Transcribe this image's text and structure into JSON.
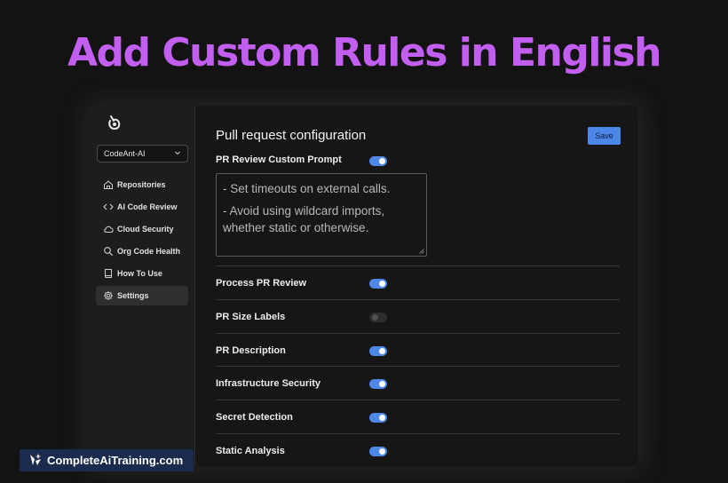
{
  "headline": "Add Custom Rules in English",
  "sidebar": {
    "org_selector": "CodeAnt-AI",
    "items": [
      {
        "label": "Repositories",
        "icon": "home-icon",
        "active": false
      },
      {
        "label": "AI Code Review",
        "icon": "code-icon",
        "active": false
      },
      {
        "label": "Cloud Security",
        "icon": "cloud-icon",
        "active": false
      },
      {
        "label": "Org Code Health",
        "icon": "search-icon",
        "active": false
      },
      {
        "label": "How To Use",
        "icon": "book-icon",
        "active": false
      },
      {
        "label": "Settings",
        "icon": "gear-icon",
        "active": true
      }
    ]
  },
  "main": {
    "title": "Pull request configuration",
    "save_label": "Save",
    "prompt_label": "PR Review Custom Prompt",
    "prompt_enabled": true,
    "prompt_lines": [
      "- Set timeouts on external calls.",
      "- Avoid using wildcard imports, whether static or otherwise."
    ],
    "settings": [
      {
        "label": "Process PR Review",
        "enabled": true
      },
      {
        "label": "PR Size Labels",
        "enabled": false
      },
      {
        "label": "PR Description",
        "enabled": true
      },
      {
        "label": "Infrastructure Security",
        "enabled": true
      },
      {
        "label": "Secret Detection",
        "enabled": true
      },
      {
        "label": "Static Analysis",
        "enabled": true
      }
    ]
  },
  "watermark": "CompleteAiTraining.com",
  "colors": {
    "accent": "#4d86e9",
    "headline": "#c25ef0",
    "background": "#131313"
  }
}
